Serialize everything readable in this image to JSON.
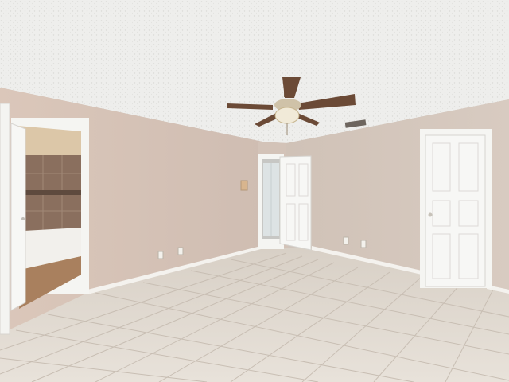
{
  "scene": {
    "description_tag": "empty-bedroom-interior",
    "colors": {
      "ceiling": "#eeeeec",
      "wall_left": "#d6c4b8",
      "wall_back": "#d2c3b8",
      "wall_right": "#d3c5bb",
      "floor": "#e2dbd2",
      "baseboard": "#f4f2ee",
      "door": "#f7f7f5",
      "trim": "#f5f5f2",
      "fan_blade": "#6b4a36",
      "fan_metal": "#cfc2a8",
      "bath_tile": "#8a6f5e",
      "bath_floor": "#a9805e"
    }
  }
}
